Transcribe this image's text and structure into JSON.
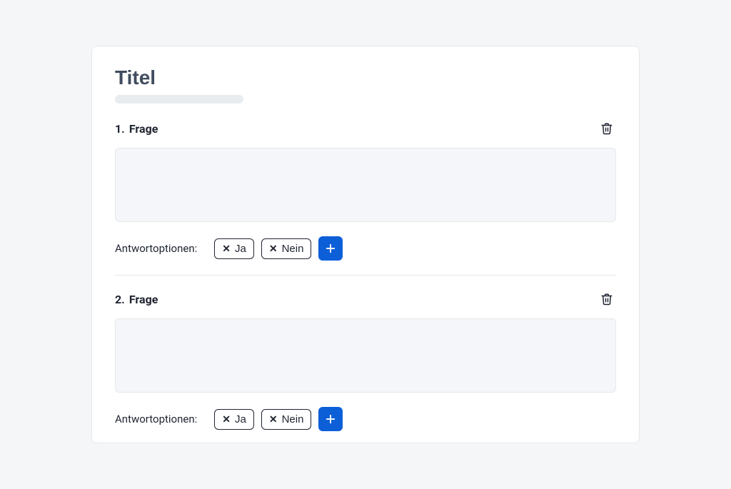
{
  "title": {
    "placeholder": "Titel",
    "value": ""
  },
  "questions": [
    {
      "numLabel": "1.",
      "heading": "Frage",
      "body": "",
      "optionsLabel": "Antwortoptionen:",
      "options": [
        "Ja",
        "Nein"
      ]
    },
    {
      "numLabel": "2.",
      "heading": "Frage",
      "body": "",
      "optionsLabel": "Antwortoptionen:",
      "options": [
        "Ja",
        "Nein"
      ]
    }
  ]
}
